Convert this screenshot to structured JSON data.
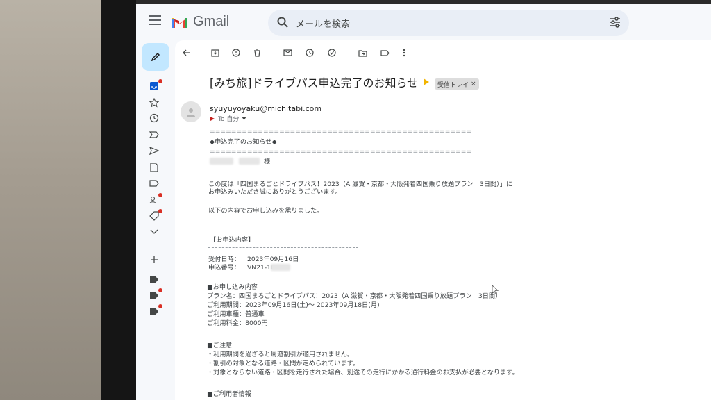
{
  "header": {
    "app_name": "Gmail",
    "search_placeholder": "メールを検索",
    "icons": [
      "menu-icon",
      "gmail-logo",
      "search-icon",
      "filter-options-icon"
    ]
  },
  "rail": {
    "icons": [
      "pencil-icon",
      "inbox-icon",
      "star-icon",
      "clock-icon",
      "important-icon",
      "send-icon",
      "file-icon",
      "label-icon",
      "people-icon",
      "tag-icon",
      "chevron-down-icon",
      "plus-icon",
      "label-icon",
      "label-icon",
      "label-icon"
    ]
  },
  "toolbar": {
    "icons": [
      "back-arrow-icon",
      "archive-icon",
      "report-spam-icon",
      "delete-icon",
      "mark-unread-icon",
      "snooze-icon",
      "add-task-icon",
      "move-to-icon",
      "label-icon",
      "more-vert-icon"
    ]
  },
  "email": {
    "subject": "[みち旅]ドライブパス申込完了のお知らせ",
    "label_chip": "受信トレイ",
    "label_close": "×",
    "sender": "syuyuyoyaku@michitabi.com",
    "to_line": "To 自分",
    "rule_line": "=================================================",
    "heading": "◆申込完了のお知らせ◆",
    "salutation": "様",
    "intro_1": "この度は「四国まるごとドライブパス！2023（A 滋賀・京都・大阪発着四国乗り放題プラン　3日間）」に",
    "intro_2": "お申込みいただき誠にありがとうございます。",
    "intro_3": "以下の内容でお申し込みを承りました。",
    "section_title": "【お申込内容】",
    "received_label": "受付日時：",
    "received_value": "2023年09月16日",
    "number_label": "申込番号：",
    "number_value": "VN21-16",
    "detail_title": "■お申し込み内容",
    "plan": "プラン名：四国まるごとドライブパス！2023（A 滋賀・京都・大阪発着四国乗り放題プラン　3日間）",
    "period": "ご利用期間：2023年09月16日(土)～ 2023年09月18日(月)",
    "vehicle": "ご利用車種：普通車",
    "price": "ご利用料金：8000円",
    "notes_title": "■ご注意",
    "note_1": "・利用期間を過ぎると周遊割引が適用されません。",
    "note_2": "・割引の対象となる道路・区間が定められています。",
    "note_3": "・対象とならない道路・区間を走行された場合、別途その走行にかかる通行料金のお支払が必要となります。",
    "user_info_title": "■ご利用者情報"
  },
  "colors": {
    "accent": "#c2e7ff",
    "notification": "#d93025",
    "label_marker": "#f2b400"
  }
}
